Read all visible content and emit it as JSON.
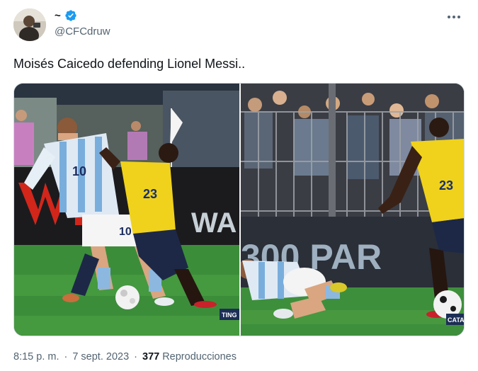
{
  "author": {
    "display_name": "~",
    "handle": "@CFCdruw",
    "verified": true
  },
  "tweet": {
    "text": "Moisés Caicedo defending Lionel Messi.."
  },
  "media": {
    "left_overlay_label": "TING",
    "right_overlay_label": "CATA",
    "left_player_numbers": [
      "10",
      "23"
    ],
    "right_player_number": "23",
    "banner_left_text": "WA",
    "banner_right_text": "300 PAR"
  },
  "meta": {
    "time": "8:15 p. m.",
    "separator": "·",
    "date": "7 sept. 2023",
    "views_count": "377",
    "views_label": "Reproducciones"
  },
  "colors": {
    "accent_blue": "#1d9bf0",
    "secondary_text": "#536471",
    "primary_text": "#0f1419"
  },
  "icons": {
    "verified": "verified-badge-icon",
    "more": "more-horizontal-icon"
  }
}
